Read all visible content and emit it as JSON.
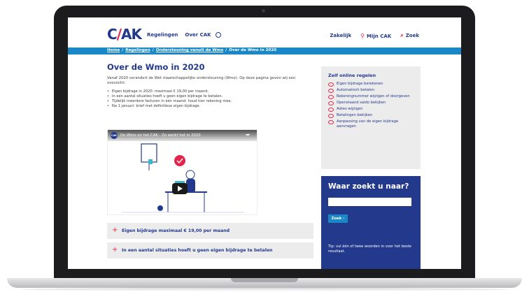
{
  "site": {
    "logo": {
      "text_c": "C",
      "text_slash": "/",
      "text_ak": "AK"
    },
    "nav_left": [
      "Regelingen",
      "Over CAK"
    ],
    "nav_right": {
      "zakelijk": "Zakelijk",
      "mijn_cak": "Mijn CAK",
      "zoek": "Zoek"
    }
  },
  "breadcrumb": {
    "items": [
      "Home",
      "Regelingen",
      "Ondersteuning vanuit de Wmo",
      "Over de Wmo in 2020"
    ],
    "separator": "/"
  },
  "main": {
    "title": "Over de Wmo in 2020",
    "intro": "Vanaf 2020 verandert de Wet maatschappelijke ondersteuning (Wmo). Op deze pagina geven wij een overzicht:",
    "bullets": [
      "Eigen bijdrage in 2020: maximaal € 19,00 per maand.",
      "In een aantal situaties hoeft u geen eigen bijdrage te betalen.",
      "Tijdelijk meerdere facturen in één maand: houd hier rekening mee.",
      "Na 1 januari: brief met definitieve eigen bijdrage."
    ],
    "video": {
      "title": "De Wmo en het CAK - Zo werkt het in 2020",
      "channel_badge": "CAK"
    },
    "accordions": [
      "Eigen bijdrage maximaal € 19,00 per maand",
      "In een aantal situaties hoeft u geen eigen bijdrage te betalen"
    ]
  },
  "sidebar": {
    "title": "Zelf online regelen",
    "items": [
      "Eigen bijdrage berekenen",
      "Automatisch betalen",
      "Rekeningnummer wijzigen of doorgeven",
      "Openstaand saldo bekijken",
      "Adres wijzigen",
      "Betalingen bekijken",
      "Aanpassing van de eigen bijdrage aanvragen"
    ]
  },
  "search": {
    "title": "Waar zoekt u naar?",
    "input_value": "",
    "button": "Zoek",
    "tip": "Tip: vul één of twee woorden in voor het beste resultaat."
  },
  "colors": {
    "brand_navy": "#233a8c",
    "brand_blue": "#1a88c7",
    "accent_red": "#e3254b",
    "panel_gray": "#ececec"
  }
}
